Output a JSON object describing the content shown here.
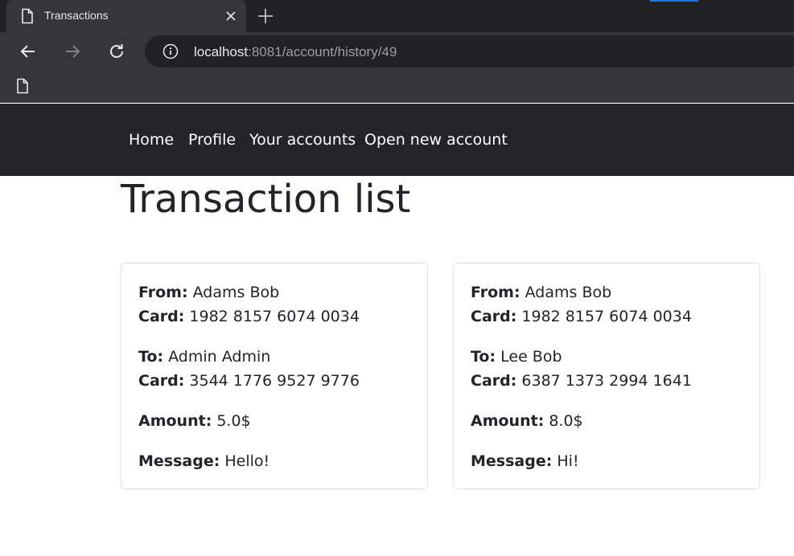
{
  "browser": {
    "tab_title": "Transactions",
    "url_host": "localhost",
    "url_rest": ":8081/account/history/49"
  },
  "nav": {
    "items": [
      "Home",
      "Profile",
      "Your accounts",
      "Open new account"
    ]
  },
  "page": {
    "title": "Transaction list"
  },
  "labels": {
    "from": "From:",
    "card": "Card:",
    "to": "To:",
    "amount": "Amount:",
    "message": "Message:"
  },
  "transactions": [
    {
      "from_name": "Adams Bob",
      "from_card": "1982 8157 6074 0034",
      "to_name": "Admin Admin",
      "to_card": "3544 1776 9527 9776",
      "amount": "5.0$",
      "message": "Hello!"
    },
    {
      "from_name": "Adams Bob",
      "from_card": "1982 8157 6074 0034",
      "to_name": "Lee Bob",
      "to_card": "6387 1373 2994 1641",
      "amount": "8.0$",
      "message": "Hi!"
    }
  ]
}
